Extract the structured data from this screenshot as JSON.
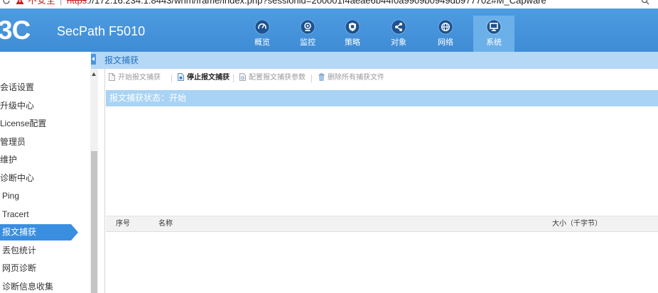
{
  "browser": {
    "icons": [
      "reload-icon",
      "warning-icon",
      "search-icon"
    ],
    "insecure_label": "不安全",
    "divider": "|",
    "url_scheme": "https",
    "url_rest": "://172.16.234.1:8443/wnm/frame/index.php?sessionid=200001f4aeae6b44f0a9909b0949db977702#M_Capware"
  },
  "header": {
    "logo_text": "3C",
    "product": "SecPath F5010",
    "nav": [
      {
        "label": "概览",
        "icon": "dashboard-gauge-icon",
        "active": false
      },
      {
        "label": "监控",
        "icon": "webcam-icon",
        "active": false
      },
      {
        "label": "策略",
        "icon": "shield-icon",
        "active": false
      },
      {
        "label": "对象",
        "icon": "share-nodes-icon",
        "active": false
      },
      {
        "label": "网络",
        "icon": "globe-icon",
        "active": false
      },
      {
        "label": "系统",
        "icon": "monitor-icon",
        "active": true
      }
    ]
  },
  "breadcrumb": {
    "current": "报文捕获"
  },
  "sidebar": {
    "items": [
      {
        "label": "会话设置",
        "sub": false,
        "active": false
      },
      {
        "label": "升级中心",
        "sub": false,
        "active": false
      },
      {
        "label": "License配置",
        "sub": false,
        "active": false
      },
      {
        "label": "管理员",
        "sub": false,
        "active": false
      },
      {
        "label": "维护",
        "sub": false,
        "active": false
      },
      {
        "label": "诊断中心",
        "sub": false,
        "active": false
      },
      {
        "label": "Ping",
        "sub": true,
        "active": false
      },
      {
        "label": "Tracert",
        "sub": true,
        "active": false
      },
      {
        "label": "报文捕获",
        "sub": true,
        "active": true
      },
      {
        "label": "丢包统计",
        "sub": true,
        "active": false
      },
      {
        "label": "网页诊断",
        "sub": true,
        "active": false
      },
      {
        "label": "诊断信息收集",
        "sub": true,
        "active": false
      }
    ]
  },
  "toolbar": {
    "buttons": [
      {
        "label": "开始报文捕获",
        "enabled": false,
        "icon": "start-capture-icon"
      },
      {
        "label": "停止报文捕获",
        "enabled": true,
        "icon": "stop-capture-icon"
      },
      {
        "label": "配置报文捕获参数",
        "enabled": false,
        "icon": "configure-capture-icon"
      },
      {
        "label": "删除所有捕获文件",
        "enabled": false,
        "icon": "trash-icon"
      }
    ]
  },
  "capture_status": {
    "text": "报文捕获状态：开始"
  },
  "capture_table": {
    "columns": [
      {
        "label": "序号"
      },
      {
        "label": "名称"
      },
      {
        "label": "大小（千字节）"
      }
    ],
    "rows": []
  },
  "colors": {
    "header_bg": "#4593da",
    "nav_active_bg": "#6cb0ea",
    "breadcrumb_bg": "#b5d8f6",
    "sidebar_active_bg": "#3a8ee0",
    "status_bg": "#a9d3f4",
    "insecure_red": "#c5221f"
  }
}
